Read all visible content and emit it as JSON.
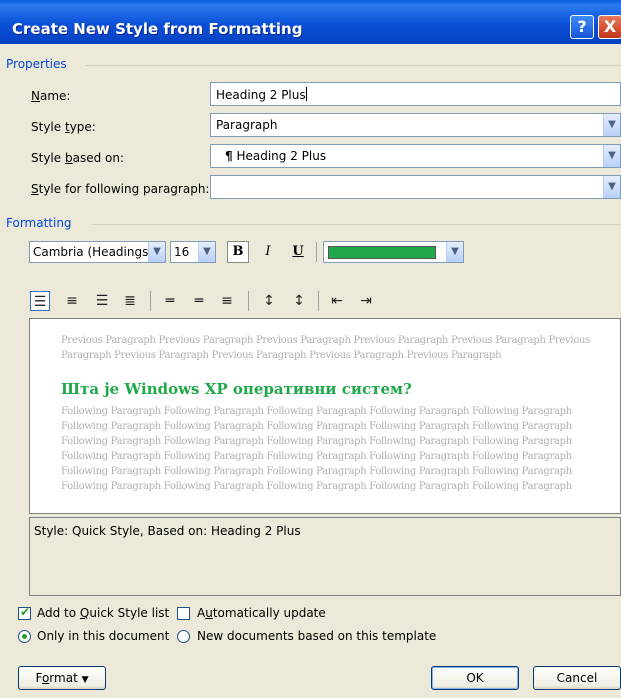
{
  "window": {
    "title": "Create New Style from Formatting",
    "help_icon": "?",
    "close_icon": "X"
  },
  "properties": {
    "group_label": "Properties",
    "name_label": "Name:",
    "name_value": "Heading 2 Plus",
    "style_type_label": "Style type:",
    "style_type_value": "Paragraph",
    "based_on_label": "Style based on:",
    "based_on_value": "Heading 2 Plus",
    "following_label": "Style for following paragraph:",
    "following_value": ""
  },
  "formatting": {
    "group_label": "Formatting",
    "font_value": "Cambria (Headings)",
    "size_value": "16",
    "bold_label": "B",
    "italic_label": "I",
    "underline_label": "U",
    "font_color": "#20a84a"
  },
  "preview": {
    "previous_lines": [
      "Previous Paragraph Previous Paragraph Previous Paragraph Previous Paragraph Previous Paragraph Previous",
      "Paragraph Previous Paragraph Previous Paragraph Previous Paragraph Previous Paragraph"
    ],
    "heading": "Шта је Windows XP оперативни систем?",
    "following_lines": [
      "Following Paragraph Following Paragraph Following Paragraph Following Paragraph Following Paragraph",
      "Following Paragraph Following Paragraph Following Paragraph Following Paragraph Following Paragraph",
      "Following Paragraph Following Paragraph Following Paragraph Following Paragraph Following Paragraph",
      "Following Paragraph Following Paragraph Following Paragraph Following Paragraph Following Paragraph",
      "Following Paragraph Following Paragraph Following Paragraph Following Paragraph Following Paragraph",
      "Following Paragraph Following Paragraph Following Paragraph Following Paragraph Following Paragraph"
    ]
  },
  "description": "Style: Quick Style, Based on: Heading 2 Plus",
  "options": {
    "add_quick_style": "Add to Quick Style list",
    "add_quick_style_checked": true,
    "auto_update": "Automatically update",
    "auto_update_checked": false,
    "only_this_doc": "Only in this document",
    "new_docs_template": "New documents based on this template"
  },
  "buttons": {
    "format": "Format",
    "ok": "OK",
    "cancel": "Cancel"
  }
}
